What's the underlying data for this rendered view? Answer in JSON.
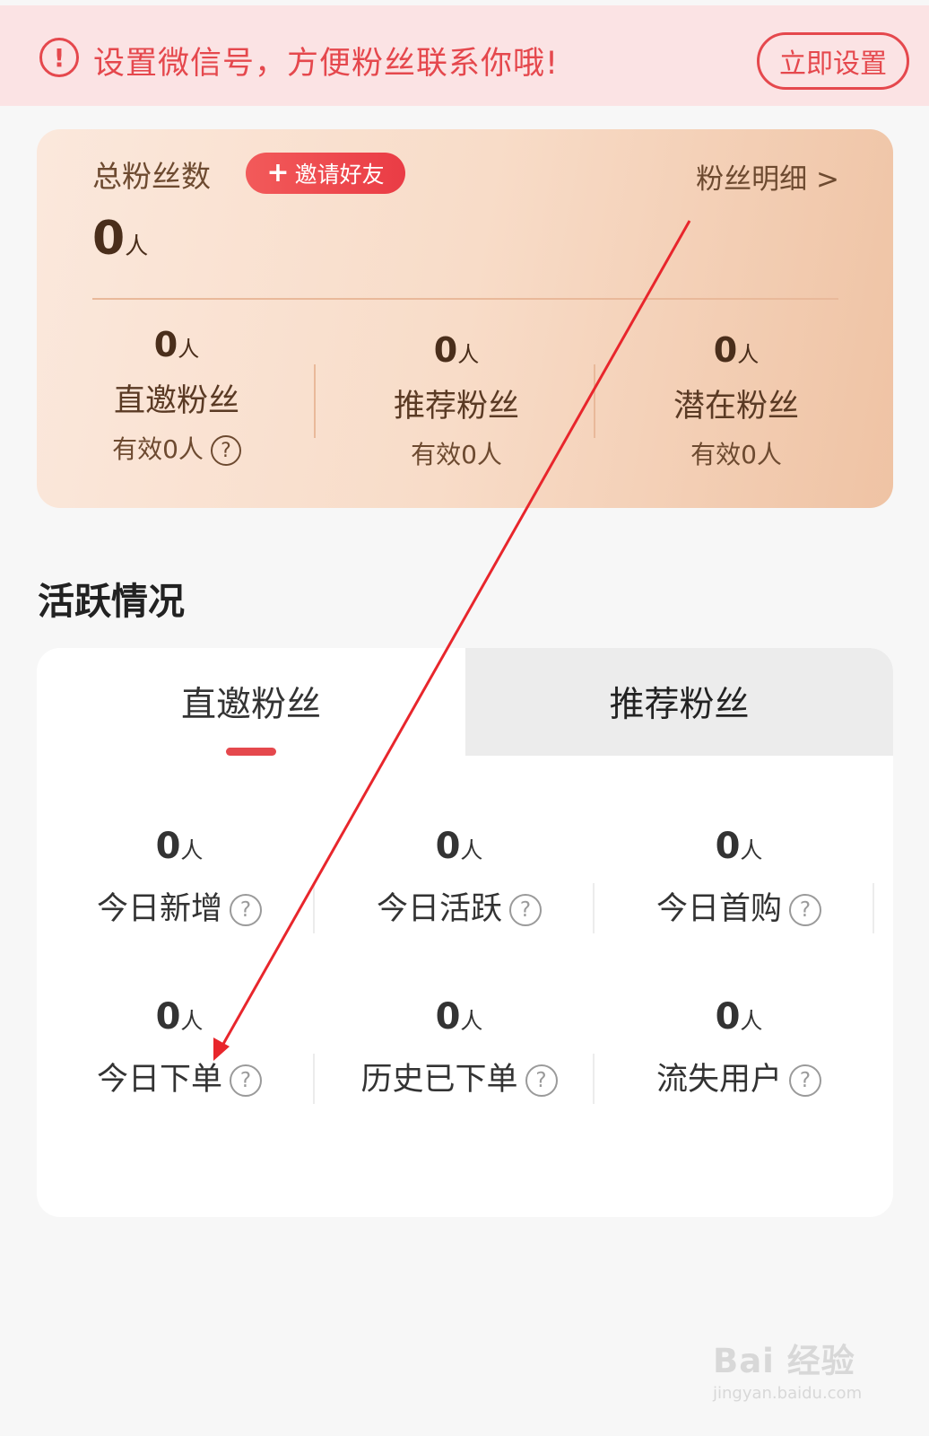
{
  "banner": {
    "icon": "exclamation-circle-icon",
    "text": "设置微信号，方便粉丝联系你哦!",
    "button_label": "立即设置"
  },
  "fan_summary": {
    "title": "总粉丝数",
    "invite_label": "邀请好友",
    "detail_link": "粉丝明细 >",
    "total_value": "0",
    "total_unit": "人",
    "columns": [
      {
        "value": "0",
        "unit": "人",
        "label": "直邀粉丝",
        "sub": "有效0人"
      },
      {
        "value": "0",
        "unit": "人",
        "label": "推荐粉丝",
        "sub": "有效0人"
      },
      {
        "value": "0",
        "unit": "人",
        "label": "潜在粉丝",
        "sub": "有效0人"
      }
    ]
  },
  "activity": {
    "section_title": "活跃情况",
    "tabs": [
      {
        "label": "直邀粉丝",
        "active": true
      },
      {
        "label": "推荐粉丝",
        "active": false
      }
    ],
    "stats": [
      {
        "value": "0",
        "unit": "人",
        "label": "今日新增"
      },
      {
        "value": "0",
        "unit": "人",
        "label": "今日活跃"
      },
      {
        "value": "0",
        "unit": "人",
        "label": "今日首购"
      },
      {
        "value": "0",
        "unit": "人",
        "label": "今日下单"
      },
      {
        "value": "0",
        "unit": "人",
        "label": "历史已下单"
      },
      {
        "value": "0",
        "unit": "人",
        "label": "流失用户"
      }
    ]
  },
  "help_icon": "?",
  "watermark": {
    "main": "Bai 经验",
    "sub": "jingyan.baidu.com"
  },
  "colors": {
    "accent": "#e5484d",
    "banner_bg": "#fbe3e4",
    "card_brown": "#6d4a30"
  }
}
